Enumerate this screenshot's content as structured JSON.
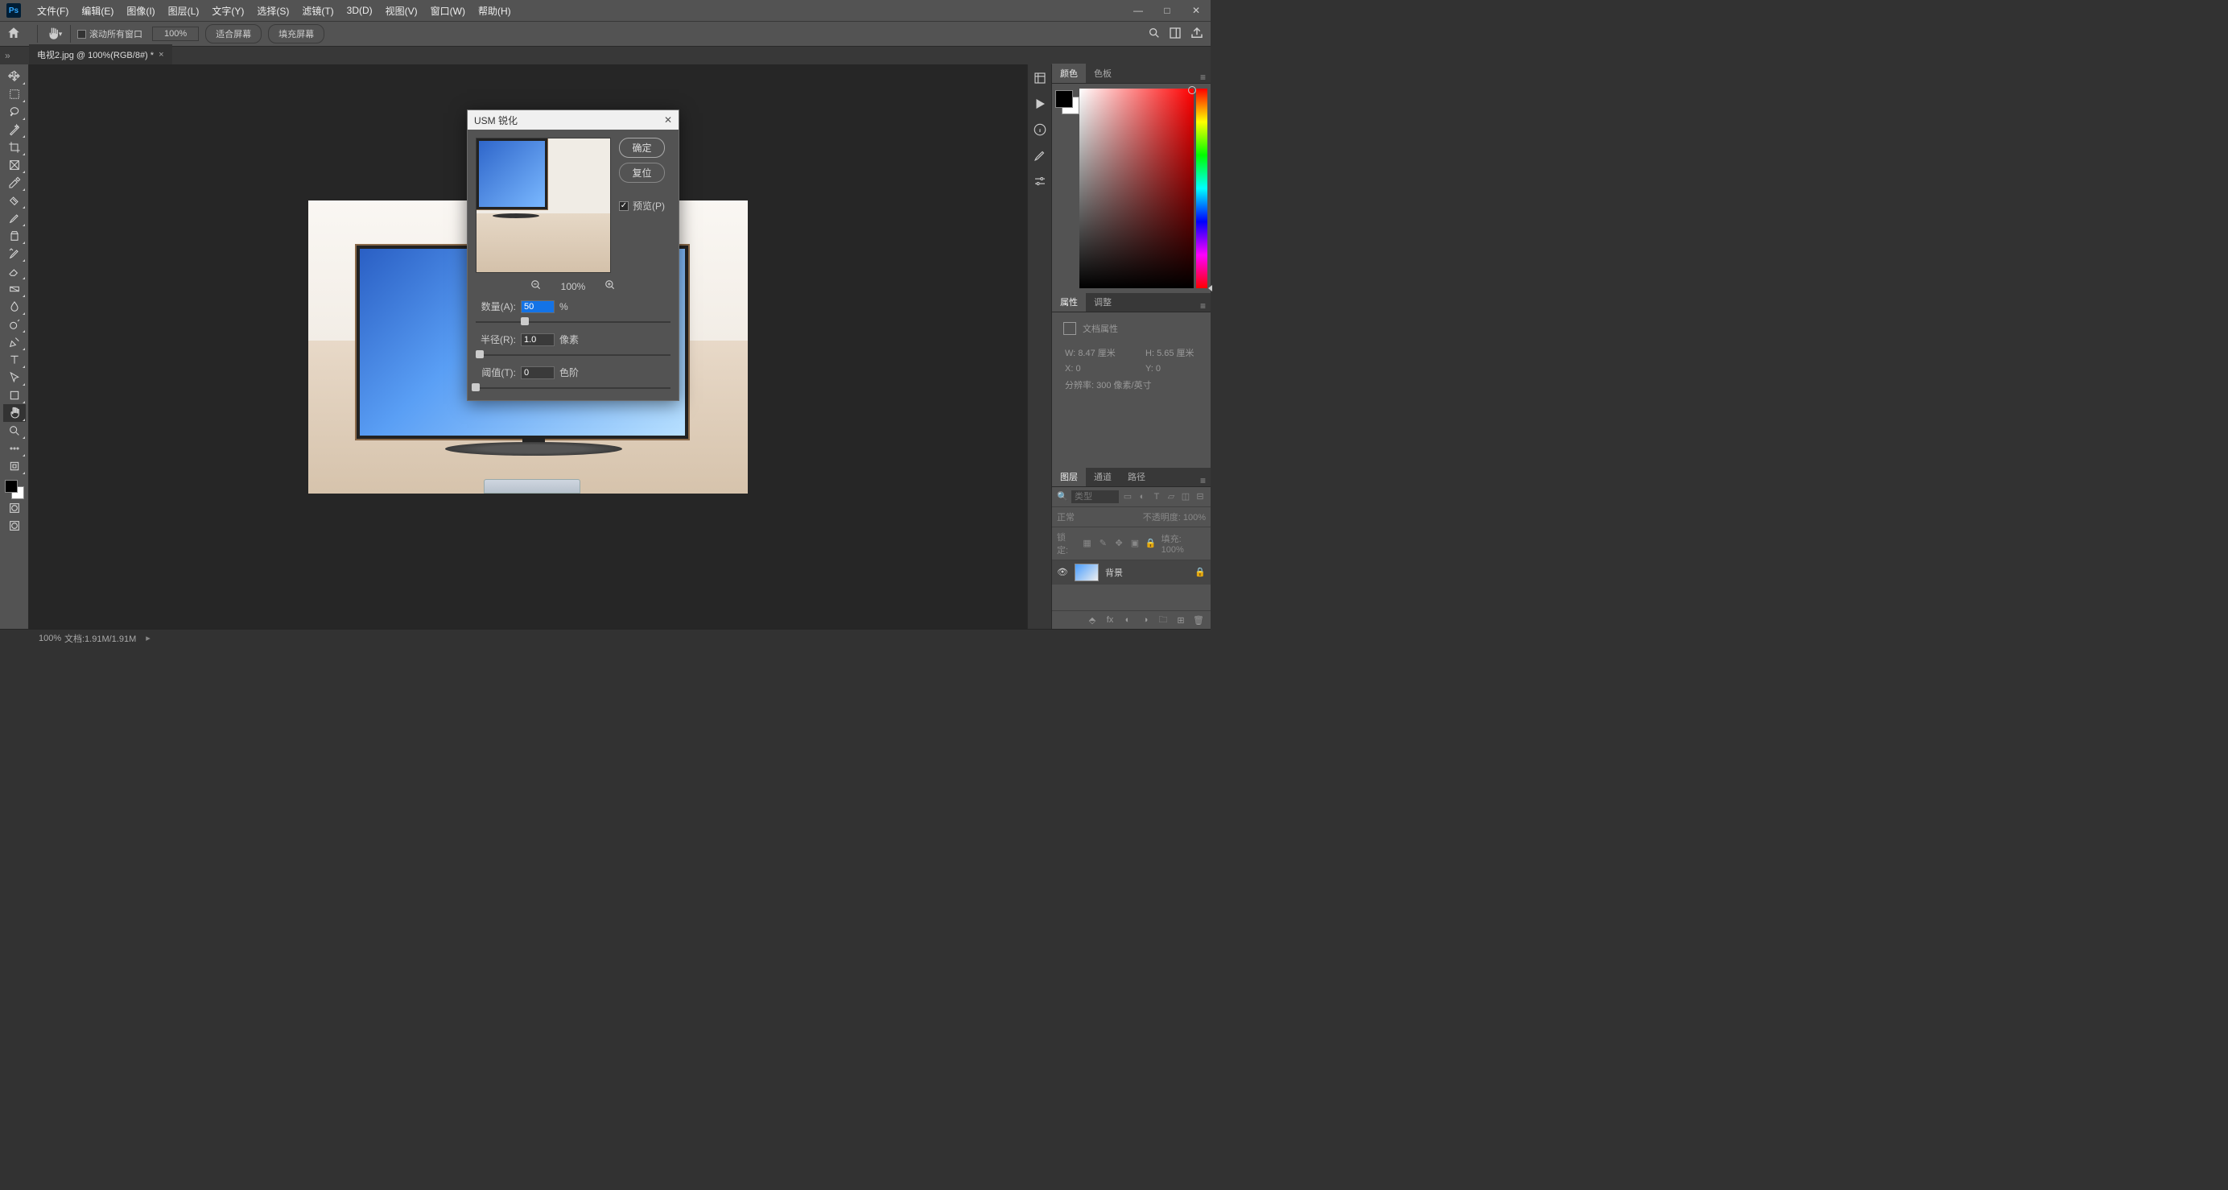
{
  "menu": [
    "文件(F)",
    "编辑(E)",
    "图像(I)",
    "图层(L)",
    "文字(Y)",
    "选择(S)",
    "滤镜(T)",
    "3D(D)",
    "视图(V)",
    "窗口(W)",
    "帮助(H)"
  ],
  "options": {
    "scrollAllWindows": "滚动所有窗口",
    "zoom": "100%",
    "fitScreen": "适合屏幕",
    "fillScreen": "填充屏幕"
  },
  "tab": {
    "title": "电视2.jpg @ 100%(RGB/8#) *"
  },
  "tools": [
    "move",
    "marquee",
    "lasso",
    "magic-wand",
    "crop",
    "frame",
    "eyedropper",
    "healing",
    "brush",
    "clone",
    "history-brush",
    "eraser",
    "gradient",
    "blur",
    "dodge",
    "pen",
    "type",
    "path-select",
    "shape",
    "hand",
    "zoom",
    "ellipsis",
    "edit-toolbar"
  ],
  "collapsedPanels": [
    "history",
    "play",
    "info",
    "brush-settings",
    "adjustments"
  ],
  "panels": {
    "color": {
      "tabs": [
        "颜色",
        "色板"
      ]
    },
    "properties": {
      "tabs": [
        "属性",
        "调整"
      ],
      "docProps": "文档属性",
      "w_label": "W:",
      "w_val": "8.47 厘米",
      "h_label": "H:",
      "h_val": "5.65 厘米",
      "x_label": "X:",
      "x_val": "0",
      "y_label": "Y:",
      "y_val": "0",
      "res_label": "分辨率:",
      "res_val": "300 像素/英寸"
    },
    "layers": {
      "tabs": [
        "图层",
        "通道",
        "路径"
      ],
      "searchPlaceholder": "类型",
      "blendMode": "正常",
      "opacityLabel": "不透明度:",
      "opacity": "100%",
      "lockLabel": "锁定:",
      "fillLabel": "填充:",
      "fill": "100%",
      "layerName": "背景"
    }
  },
  "status": {
    "zoom": "100%",
    "doc": "文档:1.91M/1.91M"
  },
  "dialog": {
    "title": "USM 锐化",
    "ok": "确定",
    "reset": "复位",
    "previewLabel": "预览(P)",
    "zoom": "100%",
    "amountLabel": "数量(A):",
    "amount": "50",
    "amountUnit": "%",
    "radiusLabel": "半径(R):",
    "radius": "1.0",
    "radiusUnit": "像素",
    "thresholdLabel": "阈值(T):",
    "threshold": "0",
    "thresholdUnit": "色阶",
    "amountSliderPos": "25%",
    "radiusSliderPos": "2%",
    "thresholdSliderPos": "0%"
  }
}
